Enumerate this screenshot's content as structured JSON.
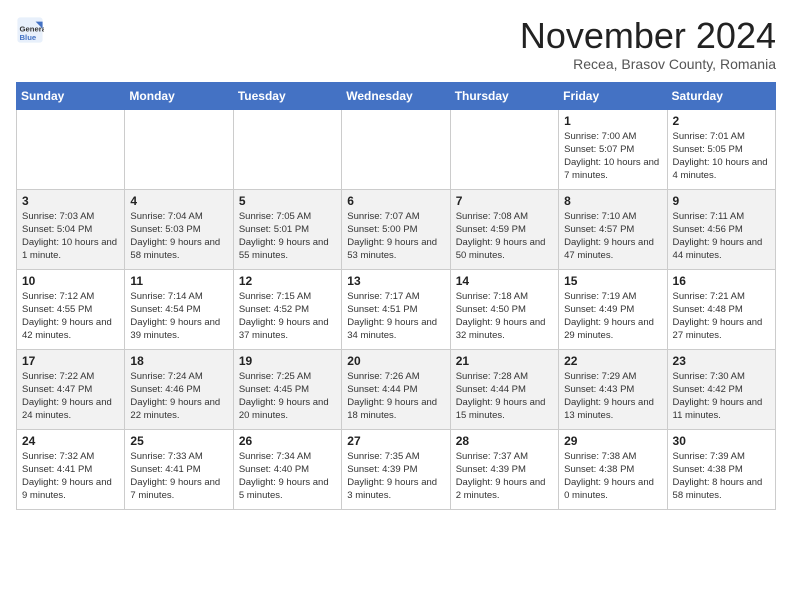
{
  "header": {
    "logo_text_general": "General",
    "logo_text_blue": "Blue",
    "month_title": "November 2024",
    "subtitle": "Recea, Brasov County, Romania"
  },
  "days_of_week": [
    "Sunday",
    "Monday",
    "Tuesday",
    "Wednesday",
    "Thursday",
    "Friday",
    "Saturday"
  ],
  "weeks": [
    [
      {
        "day": "",
        "info": ""
      },
      {
        "day": "",
        "info": ""
      },
      {
        "day": "",
        "info": ""
      },
      {
        "day": "",
        "info": ""
      },
      {
        "day": "",
        "info": ""
      },
      {
        "day": "1",
        "info": "Sunrise: 7:00 AM\nSunset: 5:07 PM\nDaylight: 10 hours and 7 minutes."
      },
      {
        "day": "2",
        "info": "Sunrise: 7:01 AM\nSunset: 5:05 PM\nDaylight: 10 hours and 4 minutes."
      }
    ],
    [
      {
        "day": "3",
        "info": "Sunrise: 7:03 AM\nSunset: 5:04 PM\nDaylight: 10 hours and 1 minute."
      },
      {
        "day": "4",
        "info": "Sunrise: 7:04 AM\nSunset: 5:03 PM\nDaylight: 9 hours and 58 minutes."
      },
      {
        "day": "5",
        "info": "Sunrise: 7:05 AM\nSunset: 5:01 PM\nDaylight: 9 hours and 55 minutes."
      },
      {
        "day": "6",
        "info": "Sunrise: 7:07 AM\nSunset: 5:00 PM\nDaylight: 9 hours and 53 minutes."
      },
      {
        "day": "7",
        "info": "Sunrise: 7:08 AM\nSunset: 4:59 PM\nDaylight: 9 hours and 50 minutes."
      },
      {
        "day": "8",
        "info": "Sunrise: 7:10 AM\nSunset: 4:57 PM\nDaylight: 9 hours and 47 minutes."
      },
      {
        "day": "9",
        "info": "Sunrise: 7:11 AM\nSunset: 4:56 PM\nDaylight: 9 hours and 44 minutes."
      }
    ],
    [
      {
        "day": "10",
        "info": "Sunrise: 7:12 AM\nSunset: 4:55 PM\nDaylight: 9 hours and 42 minutes."
      },
      {
        "day": "11",
        "info": "Sunrise: 7:14 AM\nSunset: 4:54 PM\nDaylight: 9 hours and 39 minutes."
      },
      {
        "day": "12",
        "info": "Sunrise: 7:15 AM\nSunset: 4:52 PM\nDaylight: 9 hours and 37 minutes."
      },
      {
        "day": "13",
        "info": "Sunrise: 7:17 AM\nSunset: 4:51 PM\nDaylight: 9 hours and 34 minutes."
      },
      {
        "day": "14",
        "info": "Sunrise: 7:18 AM\nSunset: 4:50 PM\nDaylight: 9 hours and 32 minutes."
      },
      {
        "day": "15",
        "info": "Sunrise: 7:19 AM\nSunset: 4:49 PM\nDaylight: 9 hours and 29 minutes."
      },
      {
        "day": "16",
        "info": "Sunrise: 7:21 AM\nSunset: 4:48 PM\nDaylight: 9 hours and 27 minutes."
      }
    ],
    [
      {
        "day": "17",
        "info": "Sunrise: 7:22 AM\nSunset: 4:47 PM\nDaylight: 9 hours and 24 minutes."
      },
      {
        "day": "18",
        "info": "Sunrise: 7:24 AM\nSunset: 4:46 PM\nDaylight: 9 hours and 22 minutes."
      },
      {
        "day": "19",
        "info": "Sunrise: 7:25 AM\nSunset: 4:45 PM\nDaylight: 9 hours and 20 minutes."
      },
      {
        "day": "20",
        "info": "Sunrise: 7:26 AM\nSunset: 4:44 PM\nDaylight: 9 hours and 18 minutes."
      },
      {
        "day": "21",
        "info": "Sunrise: 7:28 AM\nSunset: 4:44 PM\nDaylight: 9 hours and 15 minutes."
      },
      {
        "day": "22",
        "info": "Sunrise: 7:29 AM\nSunset: 4:43 PM\nDaylight: 9 hours and 13 minutes."
      },
      {
        "day": "23",
        "info": "Sunrise: 7:30 AM\nSunset: 4:42 PM\nDaylight: 9 hours and 11 minutes."
      }
    ],
    [
      {
        "day": "24",
        "info": "Sunrise: 7:32 AM\nSunset: 4:41 PM\nDaylight: 9 hours and 9 minutes."
      },
      {
        "day": "25",
        "info": "Sunrise: 7:33 AM\nSunset: 4:41 PM\nDaylight: 9 hours and 7 minutes."
      },
      {
        "day": "26",
        "info": "Sunrise: 7:34 AM\nSunset: 4:40 PM\nDaylight: 9 hours and 5 minutes."
      },
      {
        "day": "27",
        "info": "Sunrise: 7:35 AM\nSunset: 4:39 PM\nDaylight: 9 hours and 3 minutes."
      },
      {
        "day": "28",
        "info": "Sunrise: 7:37 AM\nSunset: 4:39 PM\nDaylight: 9 hours and 2 minutes."
      },
      {
        "day": "29",
        "info": "Sunrise: 7:38 AM\nSunset: 4:38 PM\nDaylight: 9 hours and 0 minutes."
      },
      {
        "day": "30",
        "info": "Sunrise: 7:39 AM\nSunset: 4:38 PM\nDaylight: 8 hours and 58 minutes."
      }
    ]
  ]
}
